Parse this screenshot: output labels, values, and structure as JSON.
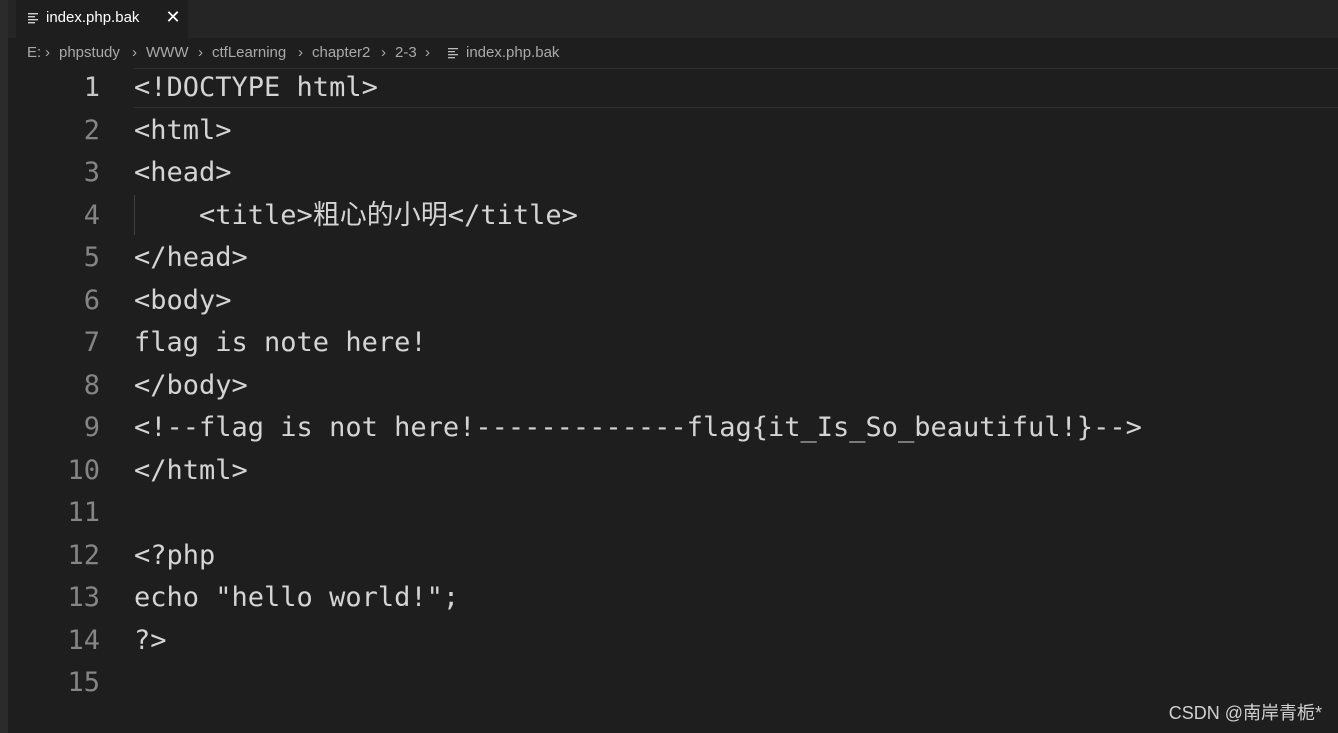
{
  "tab": {
    "title": "index.php.bak",
    "close_glyph": "✕",
    "icon": "file-lines-icon"
  },
  "breadcrumb": {
    "items": [
      "E:",
      "phpstudy",
      "WWW",
      "ctfLearning",
      "chapter2",
      "2-3",
      "index.php.bak"
    ],
    "separator": "›"
  },
  "editor": {
    "lines": [
      {
        "num": "1",
        "text": "<!DOCTYPE html>"
      },
      {
        "num": "2",
        "text": "<html>"
      },
      {
        "num": "3",
        "text": "<head>"
      },
      {
        "num": "4",
        "text": "    <title>粗心的小明</title>"
      },
      {
        "num": "5",
        "text": "</head>"
      },
      {
        "num": "6",
        "text": "<body>"
      },
      {
        "num": "7",
        "text": "flag is note here!"
      },
      {
        "num": "8",
        "text": "</body>"
      },
      {
        "num": "9",
        "text": "<!--flag is not here!-------------flag{it_Is_So_beautiful!}-->"
      },
      {
        "num": "10",
        "text": "</html>"
      },
      {
        "num": "11",
        "text": ""
      },
      {
        "num": "12",
        "text": "<?php"
      },
      {
        "num": "13",
        "text": "echo \"hello world!\";"
      },
      {
        "num": "14",
        "text": "?>"
      },
      {
        "num": "15",
        "text": ""
      }
    ],
    "active_line": 1
  },
  "watermark": "CSDN @南岸青栀*",
  "colors": {
    "background": "#1e1e1e",
    "tab_bar": "#252526",
    "text": "#d4d4d4",
    "line_number": "#858585"
  }
}
